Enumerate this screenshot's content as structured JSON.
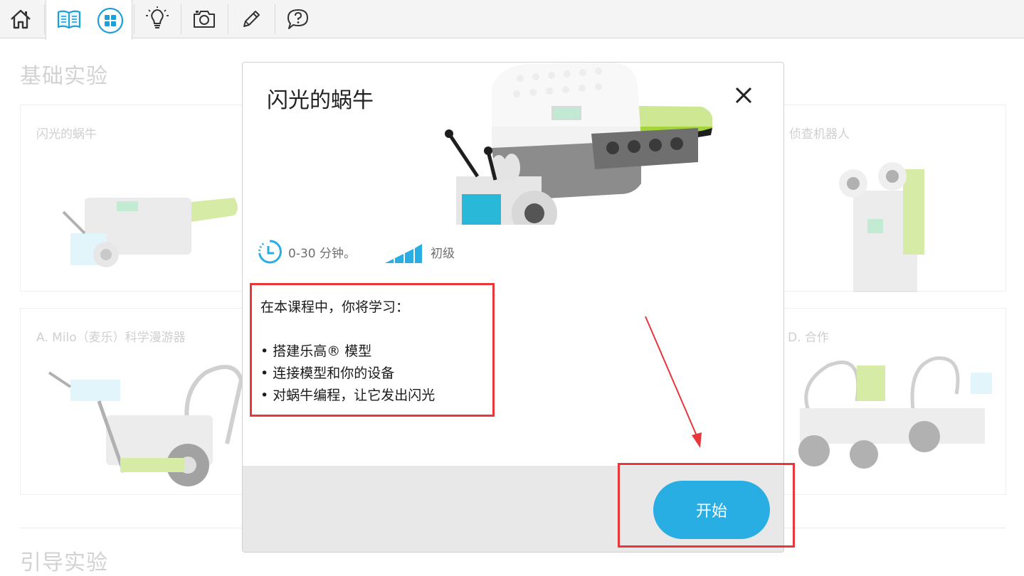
{
  "toolbar": {
    "items": [
      "home-icon",
      "book-icon",
      "grid-icon",
      "lightbulb-icon",
      "camera-icon",
      "pencil-icon",
      "help-icon"
    ]
  },
  "page": {
    "section_basic": "基础实验",
    "section_guided": "引导实验",
    "cards": [
      {
        "title": "闪光的蜗牛"
      },
      {
        "title": "侦查机器人"
      },
      {
        "title": "A. Milo（麦乐）科学漫游器"
      },
      {
        "title": "D. 合作"
      }
    ]
  },
  "modal": {
    "title": "闪光的蜗牛",
    "duration": "0-30 分钟。",
    "level": "初级",
    "learn_intro": "在本课程中，你将学习：",
    "learn_items": [
      "• 搭建乐高® 模型",
      "• 连接模型和你的设备",
      "• 对蜗牛编程，让它发出闪光"
    ],
    "start_label": "开始"
  },
  "colors": {
    "accent_blue": "#29aee4",
    "annotation_red": "#e8363b",
    "lime": "#a5d43a"
  }
}
